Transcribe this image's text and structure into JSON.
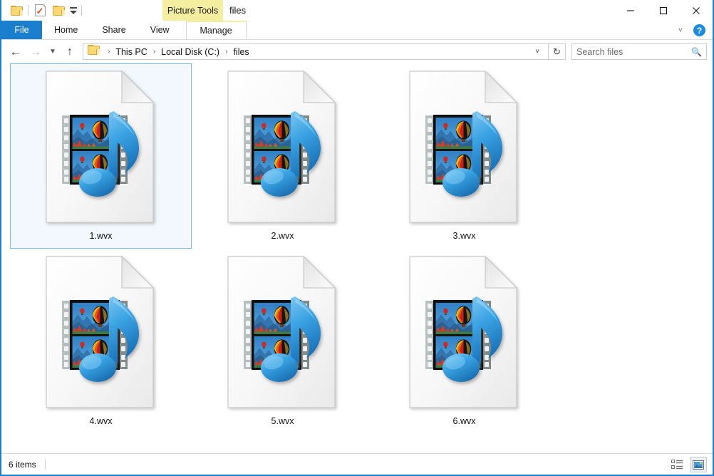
{
  "window": {
    "title": "files",
    "contextual_tab_group": "Picture Tools",
    "accent_color": "#1b7fd0",
    "contextual_color": "#f4efa0"
  },
  "quick_access": {
    "items": [
      {
        "name": "new-folder",
        "icon": "folder-icon"
      },
      {
        "name": "properties",
        "icon": "document-check-icon"
      },
      {
        "name": "folder",
        "icon": "folder-icon"
      },
      {
        "name": "customize-dropdown",
        "icon": "chevron-down-icon"
      }
    ]
  },
  "window_controls": {
    "minimize": "minimize-icon",
    "maximize": "maximize-icon",
    "close": "close-icon"
  },
  "ribbon": {
    "file_tab": "File",
    "tabs": [
      "Home",
      "Share",
      "View"
    ],
    "manage_tab": "Manage",
    "collapse_icon": "chevron-up-icon",
    "help_label": "?"
  },
  "address_bar": {
    "back_icon": "back-arrow-icon",
    "forward_icon": "forward-arrow-icon",
    "recent_icon": "chevron-down-icon",
    "up_icon": "up-arrow-icon",
    "folder_icon": "folder-icon",
    "breadcrumbs": [
      "This PC",
      "Local Disk (C:)",
      "files"
    ],
    "separator": "›",
    "dropdown_icon": "chevron-down-icon",
    "refresh_icon": "refresh-icon"
  },
  "search": {
    "placeholder": "Search files",
    "icon": "search-icon"
  },
  "files": [
    {
      "name": "1.wvx",
      "type": "media-file",
      "selected": true
    },
    {
      "name": "2.wvx",
      "type": "media-file",
      "selected": false
    },
    {
      "name": "3.wvx",
      "type": "media-file",
      "selected": false
    },
    {
      "name": "4.wvx",
      "type": "media-file",
      "selected": false
    },
    {
      "name": "5.wvx",
      "type": "media-file",
      "selected": false
    },
    {
      "name": "6.wvx",
      "type": "media-file",
      "selected": false
    }
  ],
  "status_bar": {
    "item_count": "6 items",
    "view_details_icon": "details-view-icon",
    "view_large_icons_icon": "large-icons-view-icon",
    "active_view": "large-icons"
  }
}
